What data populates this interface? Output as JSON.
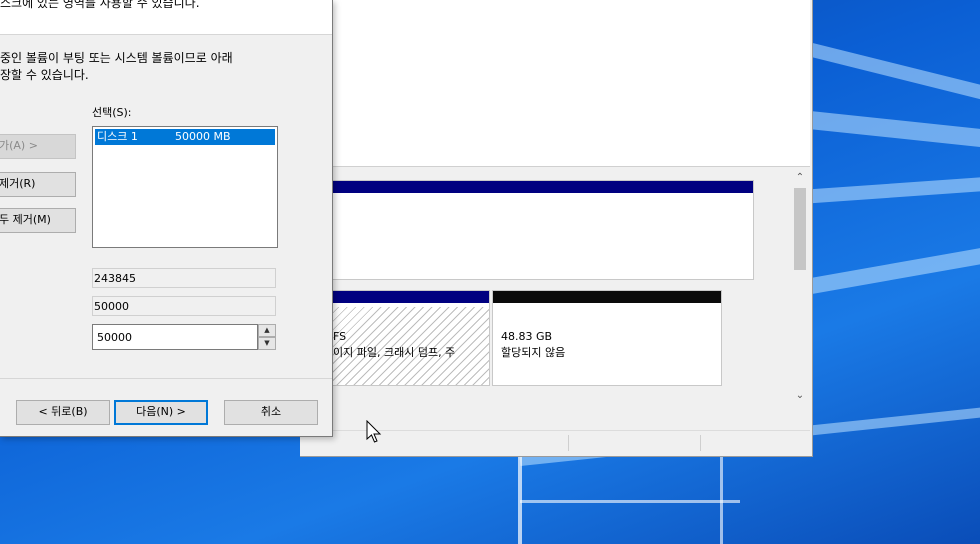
{
  "wizard": {
    "description": "스크에 있는 영역를 사용할 수 있습니다.",
    "info_line1": "중인 볼륨이 부팅 또는 시스템 볼륨이므로 아래",
    "info_line2": "장할 수 있습니다.",
    "add_button": "가(A) >",
    "remove_button": "제거(R)",
    "remove_all_button": "두 제거(M)",
    "selected_label": "선택(S):",
    "selected_list": [
      {
        "name": "디스크 1",
        "size": "50000 MB"
      }
    ],
    "total_size": "243845",
    "max_space": "50000",
    "space_amount": "50000",
    "back_button": "< 뒤로(B)",
    "next_button": "다음(N) >",
    "cancel_button": "취소"
  },
  "disk_map": {
    "partition_fs_fragment": "FS",
    "partition_status_fragment": "이지 파일, 크래시 덤프, 주",
    "unallocated_size": "48.83 GB",
    "unallocated_status": "할당되지 않음"
  },
  "colors": {
    "primary_partition_bar": "#000080",
    "unallocated_bar": "#0a0a0a",
    "selection": "#0078d7",
    "desktop": "#0b56c4"
  }
}
